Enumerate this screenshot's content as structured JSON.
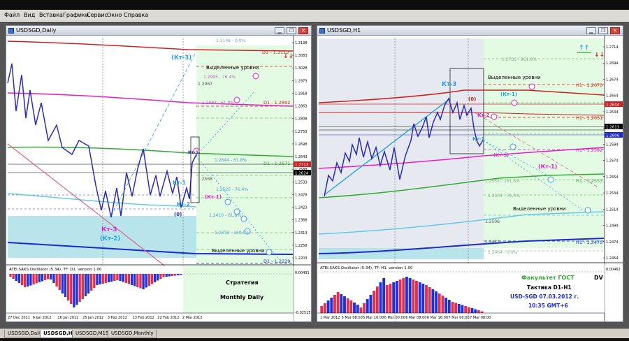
{
  "menu": [
    "Файл",
    "Вид",
    "Вставка",
    "Графики",
    "Сервис",
    "Окно",
    "Справка"
  ],
  "colors": {
    "accent": "#3b6fc4",
    "price_line": "#2b2bb4",
    "red_ma": "#cc2222",
    "magenta_ma": "#e020c8",
    "green_ma": "#33aa33",
    "light_blue_ma": "#66c8e8",
    "blue_ma": "#1a2ad0",
    "hist_red": "#e03050",
    "hist_blue": "#2030e0",
    "text_magenta": "#e020c8",
    "text_cyan": "#2aa0e0",
    "text_green": "#2aa02a"
  },
  "icons": [
    "window-icon",
    "minimize-icon",
    "restore-icon",
    "close-icon",
    "up-arrow-icon",
    "down-arrow-icon"
  ],
  "left_window": {
    "title": "USDSGD,Daily",
    "buttons": {
      "minimize": "▁",
      "restore": "❐",
      "close": "✕"
    },
    "indicator_label": "ATEI.SAKS.Oscillator (5.34), TF: D1. version 1.00",
    "strategy_title": "Стратегия",
    "strategy_subtitle": "Monthly Daily",
    "levels_label_top": "Выделенные уровни",
    "levels_label_bottom": "Выделенные уровни",
    "wave_labels": {
      "kt3_top": "(Кт-3)",
      "kt1": "Кт-1",
      "kt1_paren": "(Кт-1)",
      "kt2": "Кт-2",
      "zero": "(0)",
      "kt3_bottom": "Кт-3",
      "kt2_bottom": "(Кт-2)",
      "kt1_box": "Кт-1"
    },
    "fib_labels": [
      "1.3148 - 0.0%",
      "1.2995 - 76.4%",
      "1.2967",
      "1.2883 - 61.8%",
      "1.2644 - 61.8%",
      "1.2568",
      "1.2525 - 76.4%",
      "1.2410 - 61.8%",
      "1.2333 - 100.0%"
    ],
    "level_tags": [
      "D1 - 1.3113",
      "D1 - 1.2892",
      "D1 - 1.2671",
      "D1 - 1.2229"
    ],
    "price_ticks": [
      "1.3138",
      "1.3083",
      "1.3028",
      "1.2973",
      "1.2918",
      "1.2863",
      "1.2808",
      "1.2753",
      "1.2698",
      "1.2643",
      "1.2588",
      "1.2533",
      "1.2478",
      "1.2423",
      "1.2368",
      "1.2313",
      "1.2258",
      "1.2203"
    ],
    "current_prices": [
      "1.2713",
      "1.2624"
    ],
    "osc_ticks": [
      "0.00491",
      "-0.02515"
    ],
    "date_ticks": [
      "27 Dec 2011",
      "6 Jan 2012",
      "16 Jan 2012",
      "25 Jan 2012",
      "3 Feb 2012",
      "13 Feb 2012",
      "22 Feb 2012",
      "2 Mar 2012"
    ]
  },
  "right_window": {
    "title": "USDSGD,H1",
    "buttons": {
      "minimize": "▁",
      "restore": "❐",
      "close": "✕"
    },
    "indicator_label": "ATEI.SAKS.Oscillator (5.34), TF: H1. version 1.00",
    "levels_label_top": "Выделенные уровни",
    "levels_label_bottom": "Выделенные уровни",
    "wave_labels": {
      "kt3": "Кт-3",
      "zero": "(0)",
      "kt2": "Кт-2",
      "kt1": "Кт-1",
      "kt1_paren": "(Кт-1)",
      "kt3_paren": "(Кт-3)",
      "kt1_right": "(Кт-1)"
    },
    "fib_labels": [
      "1.2705 - 261.8%",
      "1.2553 - 161.8%",
      "1.2534 - 76.4%",
      "1.2506",
      "1.2477",
      "1.2464 - 0.0%"
    ],
    "level_tags": [
      "H1 - 1.2670",
      "H1 - 1.2631",
      "H1 - 1.2592",
      "H1 - 1.2553",
      "H1 - 1.2475"
    ],
    "price_ticks": [
      "1.2714",
      "1.2694",
      "1.2674",
      "1.2654",
      "1.2634",
      "1.2614",
      "1.2594",
      "1.2574",
      "1.2554",
      "1.2534",
      "1.2514",
      "1.2494",
      "1.2474",
      "1.2454"
    ],
    "current_prices": [
      "1.2644",
      "1.2613",
      "1.2606"
    ],
    "osc_ticks": [
      "0.00462"
    ],
    "info": {
      "faculty": "Факультет ГОСТ",
      "dv": "DV",
      "tactic": "Тактика D1-H1",
      "pair_date": "USD-SGD  07.03.2012 г.",
      "time": "10:35  GMT+6"
    },
    "date_ticks": [
      "1 Mar 2012",
      "5 Mar 08:00",
      "5 Mar 16:00",
      "6 Mar 00:00",
      "6 Mar 08:00",
      "6 Mar 16:00",
      "7 Mar 00:00",
      "7 Mar 08:00"
    ]
  },
  "tabs": [
    "USDSGD,Daily",
    "USDSGD,H1",
    "USDSGD,M15",
    "USDSGD,Monthly"
  ],
  "active_tab": "USDSGD,H1"
}
